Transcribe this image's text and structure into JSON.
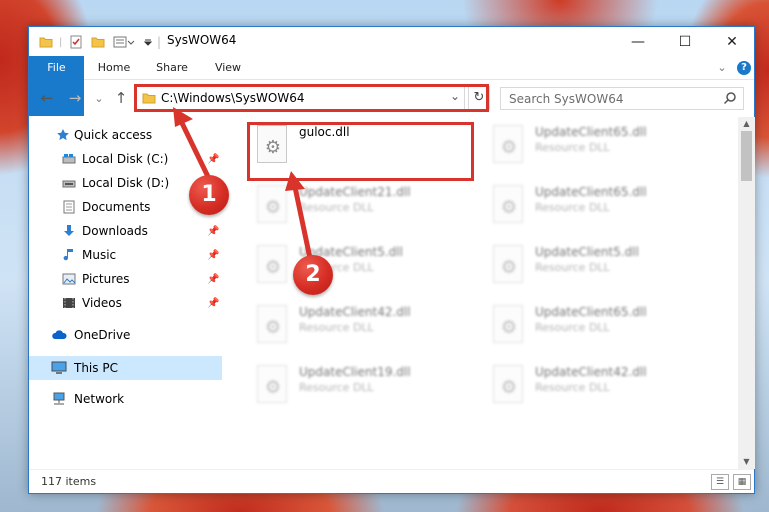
{
  "window": {
    "title": "SysWOW64",
    "controls": {
      "minimize": "—",
      "maximize": "☐",
      "close": "✕"
    }
  },
  "ribbon": {
    "tabs": [
      "File",
      "Home",
      "Share",
      "View"
    ],
    "expand_glyph": "⌄",
    "help_glyph": "?"
  },
  "navigation": {
    "back": "←",
    "forward": "→",
    "recent": "⌄",
    "up": "↑",
    "address_path": "C:\\Windows\\SysWOW64",
    "address_dropdown": "⌄",
    "refresh": "↻",
    "search_placeholder": "Search SysWOW64"
  },
  "sidebar": {
    "items": [
      {
        "label": "Quick access",
        "icon": "star-icon",
        "pinned": false
      },
      {
        "label": "Local Disk (C:)",
        "icon": "drive-icon",
        "pinned": true
      },
      {
        "label": "Local Disk (D:)",
        "icon": "drive-icon",
        "pinned": true
      },
      {
        "label": "Documents",
        "icon": "documents-icon",
        "pinned": true
      },
      {
        "label": "Downloads",
        "icon": "download-icon",
        "pinned": true
      },
      {
        "label": "Music",
        "icon": "music-icon",
        "pinned": true
      },
      {
        "label": "Pictures",
        "icon": "pictures-icon",
        "pinned": true
      },
      {
        "label": "Videos",
        "icon": "videos-icon",
        "pinned": true
      },
      {
        "label": "OneDrive",
        "icon": "cloud-icon",
        "pinned": false
      },
      {
        "label": "This PC",
        "icon": "computer-icon",
        "pinned": false,
        "selected": true
      },
      {
        "label": "Network",
        "icon": "network-icon",
        "pinned": false
      }
    ],
    "pin_glyph": "📌"
  },
  "files": [
    {
      "name": "guloc.dll",
      "type": "",
      "highlighted": true
    },
    {
      "name": "UpdateClient65.dll",
      "type": "Resource DLL"
    },
    {
      "name": "UpdateClient21.dll",
      "type": "Resource DLL"
    },
    {
      "name": "UpdateClient65.dll",
      "type": "Resource DLL"
    },
    {
      "name": "UpdateClient5.dll",
      "type": "Resource DLL"
    },
    {
      "name": "UpdateClient5.dll",
      "type": "Resource DLL"
    },
    {
      "name": "UpdateClient42.dll",
      "type": "Resource DLL"
    },
    {
      "name": "UpdateClient65.dll",
      "type": "Resource DLL"
    },
    {
      "name": "UpdateClient19.dll",
      "type": "Resource DLL"
    },
    {
      "name": "UpdateClient42.dll",
      "type": "Resource DLL"
    }
  ],
  "status": {
    "item_count": "117 items"
  },
  "annotations": [
    {
      "number": "1",
      "target": "address bar"
    },
    {
      "number": "2",
      "target": "guloc.dll"
    }
  ],
  "colors": {
    "accent": "#1979ca",
    "annotation_red": "#d9342b",
    "selection": "#cce8ff"
  }
}
